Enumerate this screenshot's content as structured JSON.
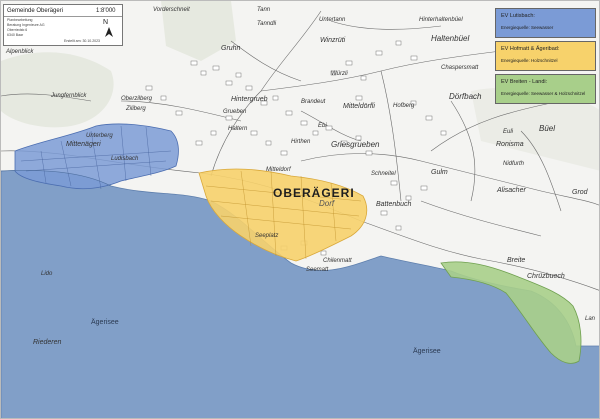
{
  "title_box": {
    "municipality": "Gemeinde Oberägeri",
    "scale": "1:8'000",
    "north": "N",
    "lines": [
      "Planbearbeitung",
      "Beratung Ingenieure AG",
      "Oberriedstr.6",
      "6340 Baar"
    ],
    "date": "Erstellt am: 30.10.2023"
  },
  "legend": [
    {
      "title": "EV Lutisbach:",
      "subtitle": "Energiequelle: Seewasser",
      "color": "#7b9bd6"
    },
    {
      "title": "EV Hofmatt & Ägeribad:",
      "subtitle": "Energiequelle: Holzschnitzel",
      "color": "#f7d26b"
    },
    {
      "title": "EV Breiten - Landi:",
      "subtitle": "Energiequelle: Seewasser & Holzschnitzel",
      "color": "#a8cf8a"
    }
  ],
  "town": {
    "name": "OBERÄGERI",
    "sub": "Dorf"
  },
  "lake": {
    "name1": "Ägerisee",
    "name2": "Ägerisee"
  },
  "places": [
    "Tann",
    "Tanndli",
    "Untertann",
    "Hinterhaltenbüel",
    "Vorderschneit",
    "Winzrüti",
    "Haltenbüel",
    "Chaspersmatt",
    "Alpenblick",
    "Gruhn",
    "Jungfernblick",
    "Oberzilberg",
    "Ziliberg",
    "Hintergrueb",
    "Grueben",
    "Haltern",
    "Brandeut",
    "Würzli",
    "Mitteldörfli",
    "Hofberg",
    "Dörfbach",
    "Hirthen",
    "Ebi",
    "Mittenägeri",
    "Unterberg",
    "Ludisbach",
    "Mitteldorf",
    "Griesgrueben",
    "Gulm",
    "Ronisma",
    "Euli",
    "Büel",
    "Nidfurth",
    "Alisacher",
    "Grod",
    "Battenbuch",
    "Seeplatz",
    "Seematt",
    "Chilenmatt",
    "Schneitel",
    "Breite",
    "Chrüzbuech",
    "Lido",
    "Riederen",
    "Lan",
    "Dorf"
  ]
}
